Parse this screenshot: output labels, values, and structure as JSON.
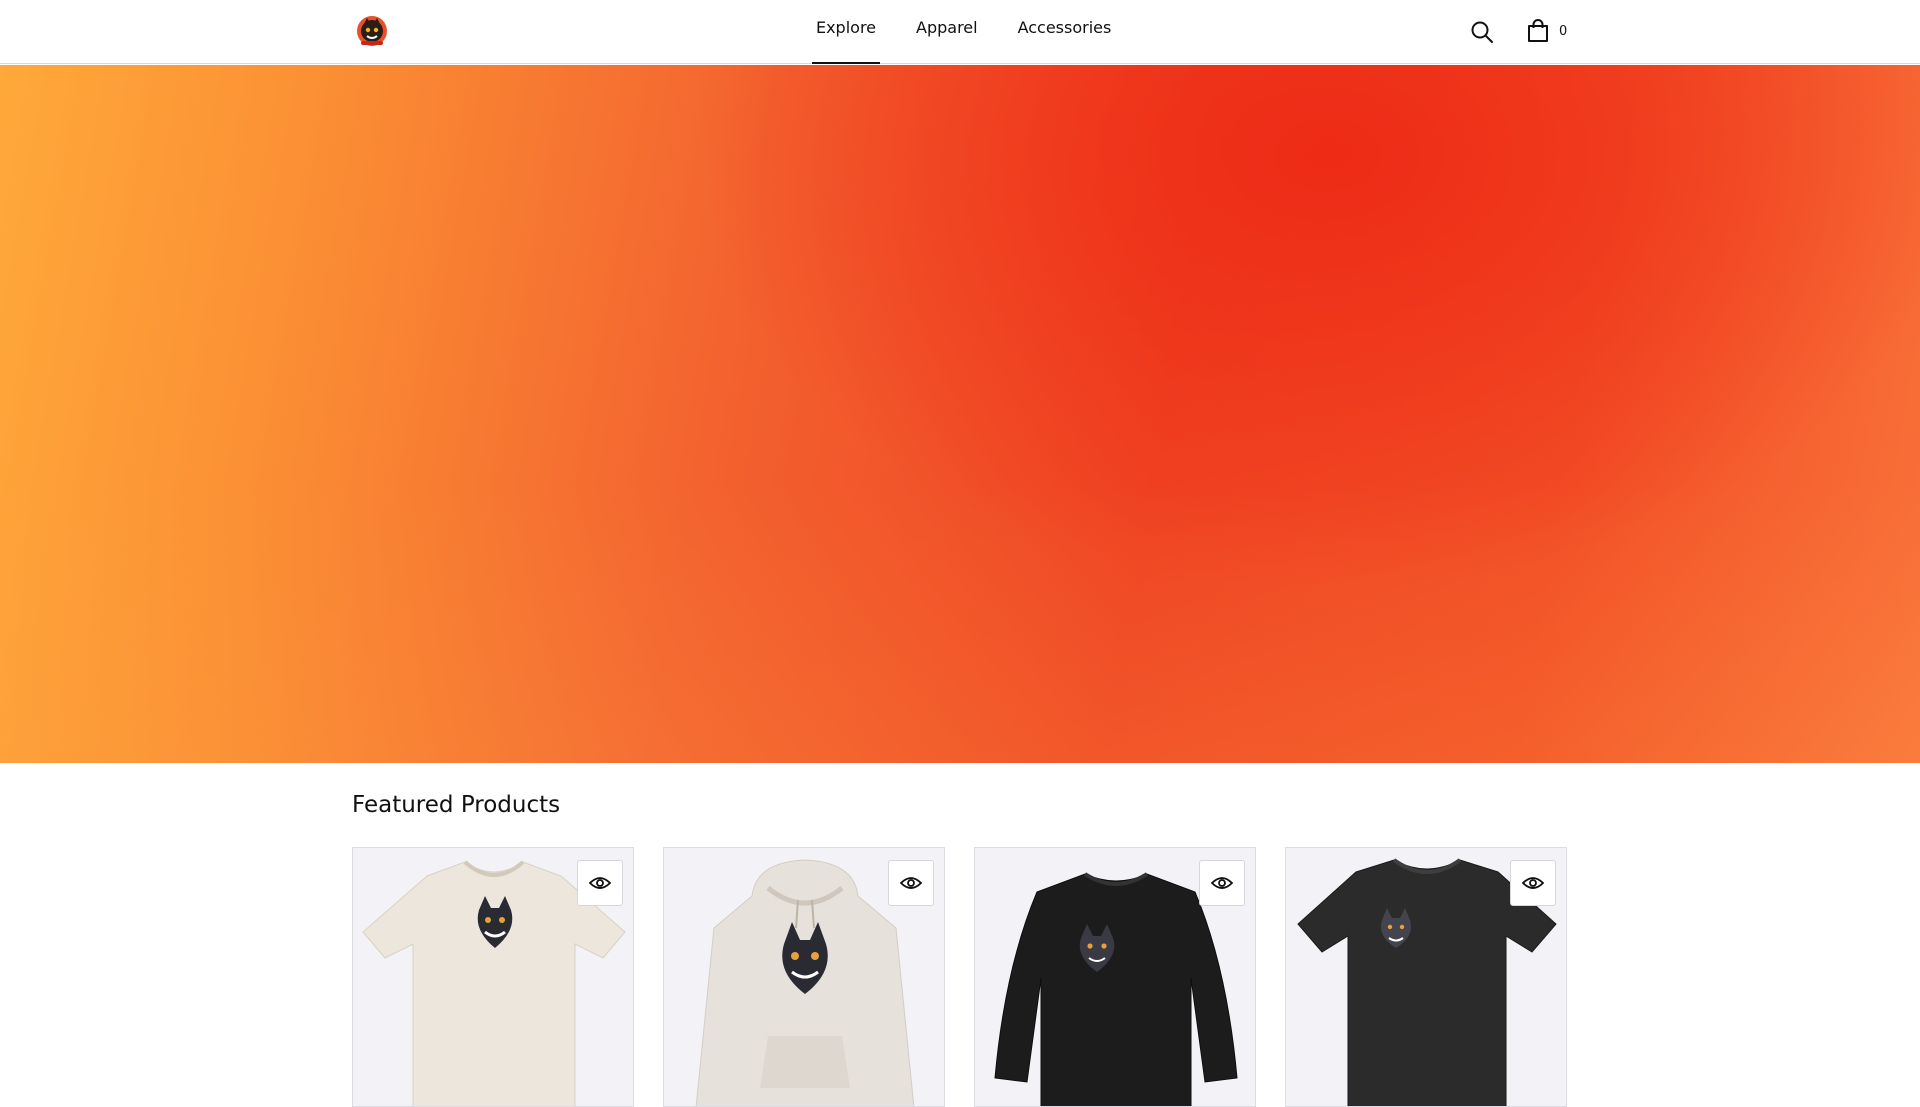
{
  "header": {
    "logo_icon": "cat-mascot-logo",
    "nav": [
      {
        "label": "Explore",
        "active": true
      },
      {
        "label": "Apparel",
        "active": false
      },
      {
        "label": "Accessories",
        "active": false
      }
    ],
    "search_icon": "search-icon",
    "cart_icon": "shopping-bag-icon",
    "cart_count": "0"
  },
  "hero": {
    "colors": {
      "left": "#ffa93a",
      "center": "#ef4423",
      "top_right": "#ee2b16",
      "right": "#f9723a"
    }
  },
  "featured": {
    "title": "Featured Products",
    "products": [
      {
        "garment": "t-shirt",
        "color": "#ece6dc",
        "quick_view_icon": "eye-icon"
      },
      {
        "garment": "hoodie",
        "color": "#e6e1db",
        "quick_view_icon": "eye-icon"
      },
      {
        "garment": "sweatshirt",
        "color": "#1c1c1c",
        "quick_view_icon": "eye-icon"
      },
      {
        "garment": "t-shirt",
        "color": "#2b2b2b",
        "quick_view_icon": "eye-icon"
      }
    ]
  }
}
